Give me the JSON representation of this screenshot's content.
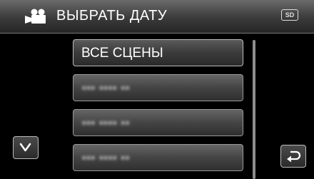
{
  "header": {
    "title": "ВЫБРАТЬ ДАТУ",
    "mode_icon": "video-camera-icon",
    "media_badge": "SD"
  },
  "list": {
    "items": [
      {
        "label": "ВСЕ СЦЕНЫ",
        "selected": true
      },
      {
        "label": "▪▪▪ ▪▪▪▪ ▪▪",
        "obscured": true
      },
      {
        "label": "▪▪▪ ▪▪▪▪ ▪▪",
        "obscured": true
      },
      {
        "label": "▪▪▪ ▪▪▪▪ ▪▪",
        "obscured": true
      }
    ]
  },
  "controls": {
    "scroll_down_icon": "chevron-down-icon",
    "back_icon": "return-arrow-icon"
  }
}
